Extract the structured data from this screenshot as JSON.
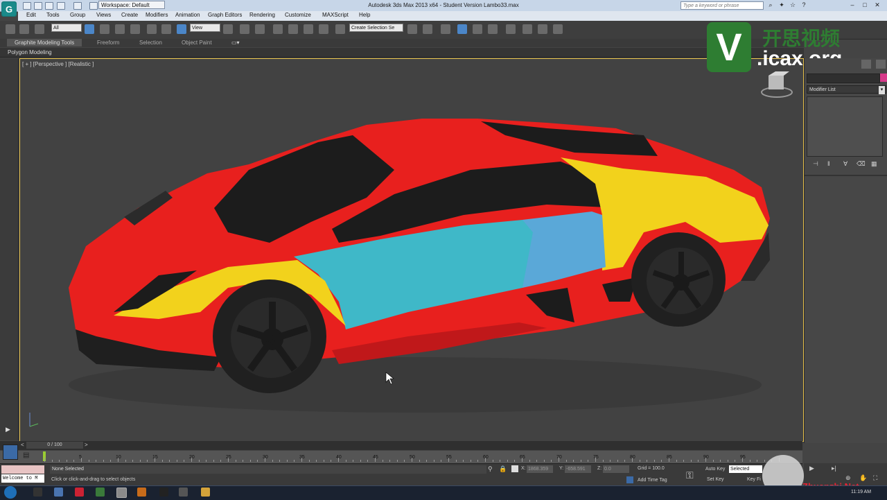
{
  "title_bar": {
    "workspace": "Workspace: Default",
    "title": "Autodesk 3ds Max  2013 x64  -  Student Version    Lambo33.max",
    "search_placeholder": "Type a keyword or phrase"
  },
  "menu": [
    "Edit",
    "Tools",
    "Group",
    "Views",
    "Create",
    "Modifiers",
    "Animation",
    "Graph Editors",
    "Rendering",
    "Customize",
    "MAXScript",
    "Help"
  ],
  "toolbar": {
    "filter_value": "All",
    "refcoord_value": "View",
    "selection_set_placeholder": "Create Selection Se"
  },
  "ribbon": {
    "tabs": [
      "Graphite Modeling Tools",
      "Freeform",
      "Selection",
      "Object Paint"
    ],
    "sub_label": "Polygon Modeling"
  },
  "viewport": {
    "label": "[ + ] [Perspective ] [Realistic ]",
    "border_color": "#e8c24b",
    "car_colors": {
      "red": "#e8201e",
      "yellow": "#f2d21c",
      "cyan": "#3fb8c8",
      "light_blue": "#5aa8d8",
      "glass": "#1c1c1c",
      "tire": "#252525"
    }
  },
  "command_panel": {
    "modifier_list": "Modifier List",
    "accent_color": "#d63a8a"
  },
  "timeline": {
    "frame_display": "0 / 100",
    "ruler_labels": [
      "5",
      "10",
      "15",
      "20",
      "25",
      "30",
      "35",
      "40",
      "45",
      "50",
      "55",
      "60",
      "65",
      "70",
      "75",
      "80",
      "85",
      "90",
      "95"
    ]
  },
  "status": {
    "selection": "None Selected",
    "prompt": "Click or click-and-drag to select objects",
    "maxscript_listener": "Welcome to M",
    "x_label": "X:",
    "x_value": "1868.359",
    "y_label": "Y:",
    "y_value": "-658.591",
    "z_label": "Z:",
    "z_value": "0.0",
    "grid": "Grid = 100.0",
    "add_time_tag": "Add Time Tag",
    "auto_key": "Auto Key",
    "set_key": "Set Key",
    "key_mode": "Selected",
    "key_filters": "Key Fi"
  },
  "taskbar": {
    "clock": "11:19 AM"
  },
  "watermark": {
    "logo_letter": "V",
    "chinese": "开思视频",
    "site": ".icax.org",
    "site2": "Zhuanzhi.Net"
  }
}
